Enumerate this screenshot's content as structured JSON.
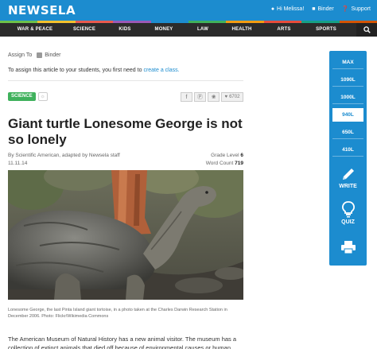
{
  "app": {
    "logo": "NEWSELA"
  },
  "topnav": {
    "greeting": "Hi Melissa!",
    "binder": "Binder",
    "support": "Support"
  },
  "stripe_colors": [
    "#6cc14a",
    "#f2c12e",
    "#e85a4f",
    "#9b59b6",
    "#1c8ccf",
    "#3fb15c",
    "#f39c12",
    "#e74c3c",
    "#16a085",
    "#d35400"
  ],
  "categories": [
    "WAR & PEACE",
    "SCIENCE",
    "KIDS",
    "MONEY",
    "LAW",
    "HEALTH",
    "ARTS",
    "SPORTS"
  ],
  "assign": {
    "label": "Assign To",
    "binder": "Binder",
    "note_prefix": "To assign this article to your students, you first need to",
    "note_link": "create a class."
  },
  "article": {
    "tag": "SCIENCE",
    "likes": "6702",
    "title": "Giant turtle Lonesome George is not so lonely",
    "byline": "By Scientific American, adapted by Newsela staff",
    "date": "11.11.14",
    "grade_label": "Grade Level",
    "grade_value": "6",
    "wordcount_label": "Word Count",
    "wordcount_value": "719",
    "caption": "Lonesome George, the last Pinta Island giant tortoise, in a photo taken at the Charles Darwin Research Station in December 2006. Photo: Flickr/Wikimedia Commons",
    "body": "The American Museum of Natural History has a new animal visitor. The museum has a collection of extinct animals that died off because of environmental causes or human"
  },
  "levels": [
    "MAX",
    "1090L",
    "1000L",
    "940L",
    "650L",
    "410L"
  ],
  "selected_level": "940L",
  "tools": {
    "write": "WRITE",
    "quiz": "QUIZ"
  }
}
